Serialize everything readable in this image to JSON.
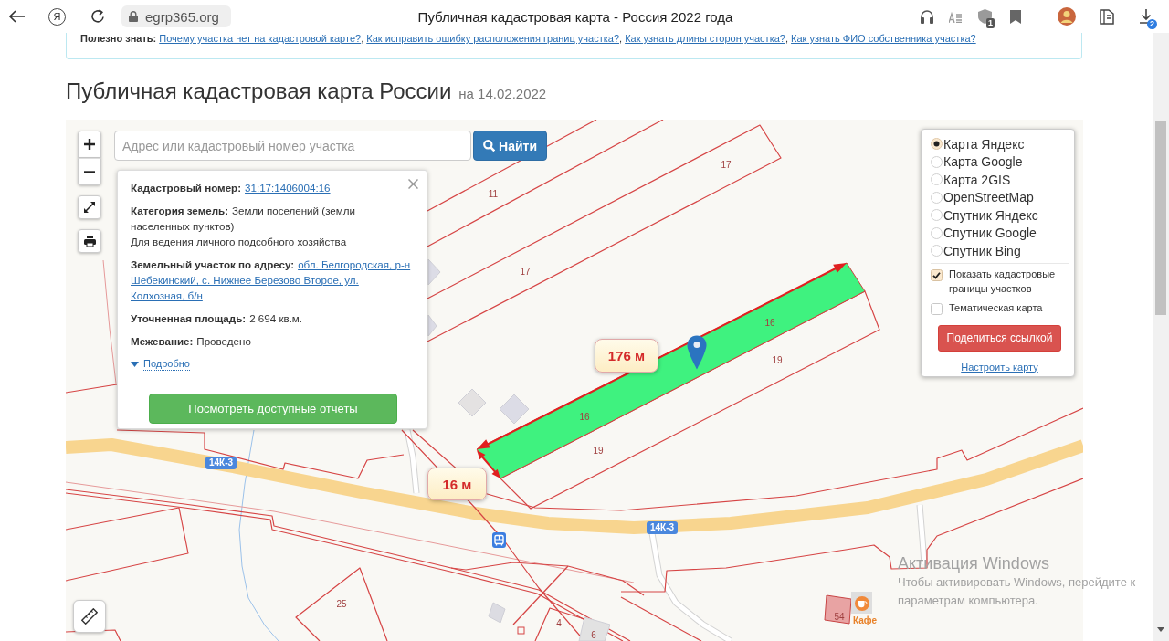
{
  "browser": {
    "logo": "Я",
    "address": "egrp365.org",
    "tab_title": "Публичная кадастровая карта - Россия 2022 года",
    "extension_badge": "1",
    "downloads_badge": "2"
  },
  "tips": {
    "label": "Полезно знать:",
    "separator": ", ",
    "links": [
      "Почему участка нет на кадастровой карте?",
      "Как исправить ошибку расположения границ участка?",
      "Как узнать длины сторон участка?",
      "Как узнать ФИО собственника участка?"
    ]
  },
  "page_title": {
    "title": "Публичная кадастровая карта России",
    "date": "на 14.02.2022"
  },
  "map": {
    "search": {
      "placeholder": "Адрес или кадастровый номер участка",
      "button": "Найти"
    },
    "parcel_popup": {
      "fields": [
        {
          "kind": "link",
          "label": "Кадастровый номер:",
          "value": "31:17:1406004:16"
        },
        {
          "kind": "text",
          "label": "Категория земель:",
          "value": "Земли поселений (земли населенных пунктов)",
          "note": "Для ведения личного подсобного хозяйства"
        },
        {
          "kind": "address",
          "label": "Земельный участок по адресу:",
          "value_lines": [
            "обл. Белгородская, р-н",
            "Шебекинский, с. Нижнее Березово Второе, ул.",
            "Колхозная, б/н"
          ]
        },
        {
          "kind": "text",
          "label": "Уточненная площадь:",
          "value": "2 694 кв.м."
        },
        {
          "kind": "text",
          "label": "Межевание:",
          "value": "Проведено"
        }
      ],
      "details_link": "Подробно",
      "reports_button": "Посмотреть доступные отчеты"
    },
    "layers": {
      "options": [
        {
          "label": "Карта Яндекс",
          "selected": true
        },
        {
          "label": "Карта Google",
          "selected": false
        },
        {
          "label": "Карта 2GIS",
          "selected": false
        },
        {
          "label": "OpenStreetMap",
          "selected": false
        },
        {
          "label": "Спутник Яндекс",
          "selected": false
        },
        {
          "label": "Спутник Google",
          "selected": false
        },
        {
          "label": "Спутник Bing",
          "selected": false
        }
      ],
      "checkboxes": [
        {
          "label": "Показать кадастровые границы участков",
          "checked": true
        },
        {
          "label": "Тематическая карта",
          "checked": false
        }
      ],
      "share_button": "Поделиться ссылкой",
      "settings_link": "Настроить карту"
    },
    "measurements": [
      {
        "kind": "length",
        "text": "176 м"
      },
      {
        "kind": "width",
        "text": "16 м"
      }
    ],
    "parcel_numbers": [
      "11",
      "17",
      "17",
      "16",
      "16",
      "19",
      "19",
      "25",
      "4",
      "6",
      "54"
    ],
    "road_labels": [
      "14К-3",
      "14К-3"
    ],
    "poi": {
      "label": "Кафе"
    }
  },
  "os_notice": {
    "title": "Активация Windows",
    "lines": [
      "Чтобы активировать Windows, перейдите к",
      "параметрам компьютера."
    ]
  }
}
